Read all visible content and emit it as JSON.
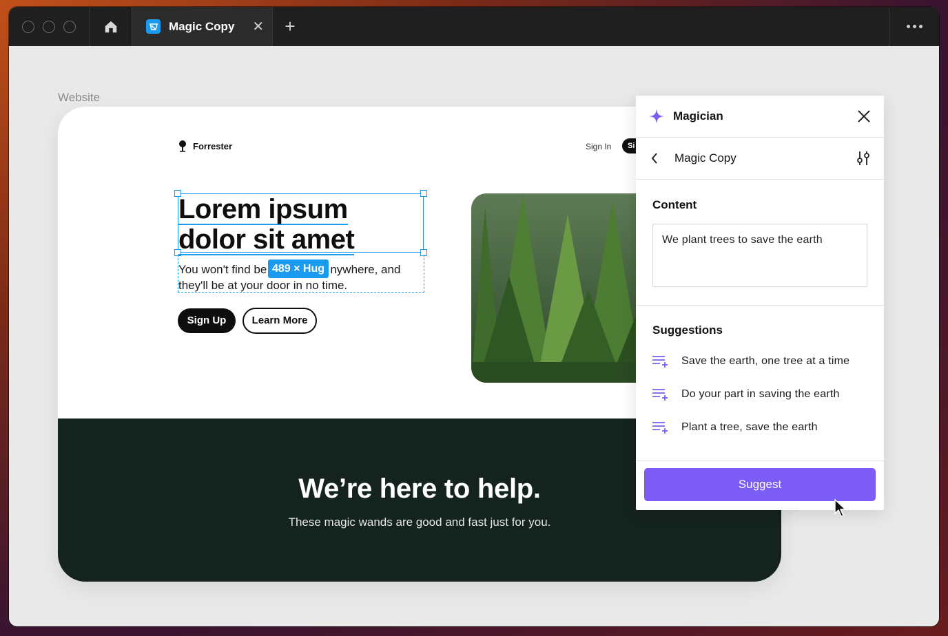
{
  "browser": {
    "tab_title": "Magic Copy",
    "tab_close": "✕",
    "new_tab": "+"
  },
  "canvas": {
    "frame_label": "Website"
  },
  "site": {
    "brand": "Forrester",
    "nav_signin": "Sign In",
    "nav_signup_partial": "Si",
    "hero_title_line1": "Lorem ipsum",
    "hero_title_line2": "dolor sit amet",
    "hero_sub_line1_start": "You won't find be",
    "hero_sub_line1_end": "nywhere, and",
    "hero_sub_line2": "they'll be at your door in no time.",
    "size_badge": "489 × Hug",
    "btn_signup": "Sign Up",
    "btn_learn": "Learn More",
    "footer_title": "We’re here to help.",
    "footer_sub": "These magic wands are good and fast just for you."
  },
  "panel": {
    "title": "Magician",
    "subtitle": "Magic Copy",
    "content_label": "Content",
    "content_value": "We plant trees to save the earth",
    "suggestions_label": "Suggestions",
    "suggestions": [
      "Save the earth, one tree at a time",
      "Do your part in saving the earth",
      "Plant a tree, save the earth"
    ],
    "suggest_button": "Suggest"
  },
  "colors": {
    "accent_blue": "#1a9bf0",
    "accent_purple": "#7b5cf5",
    "footer_dark": "#15231f"
  }
}
